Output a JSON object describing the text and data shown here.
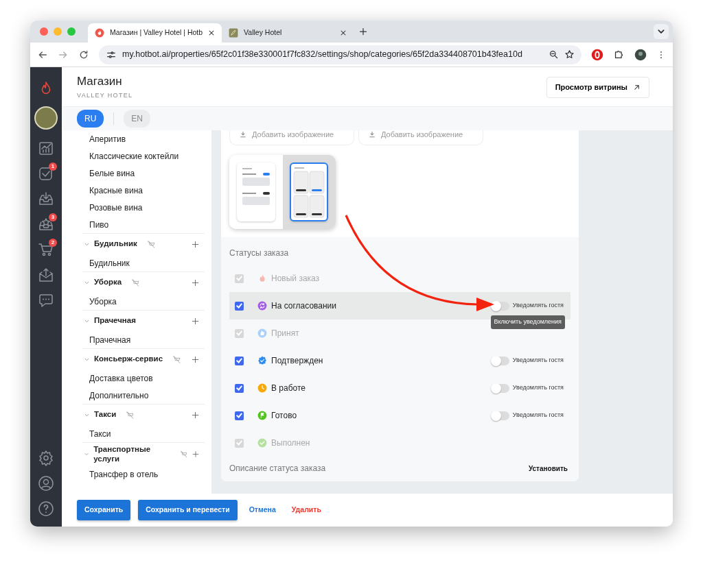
{
  "browser": {
    "tabs": [
      {
        "title": "Магазин | Valley Hotel | Hotb",
        "selected": true
      },
      {
        "title": "Valley Hotel",
        "selected": false
      }
    ],
    "url": "my.hotbot.ai/properties/65f2c01f38e330001f7fc832/settings/shop/categories/65f2da334408701b43fea10d"
  },
  "rail_badges": [
    "1",
    "3",
    "2"
  ],
  "header": {
    "title": "Магазин",
    "subtitle": "VALLEY HOTEL",
    "storefront_button": "Просмотр витрины"
  },
  "languages": [
    {
      "code": "RU",
      "selected": true
    },
    {
      "code": "EN",
      "selected": false
    }
  ],
  "categories": [
    {
      "children": [
        {
          "label": "Аперитив"
        },
        {
          "label": "Классические коктейли"
        },
        {
          "label": "Белые вина"
        },
        {
          "label": "Красные вина"
        },
        {
          "label": "Розовые вина"
        },
        {
          "label": "Пиво"
        }
      ]
    },
    {
      "title": "Будильник",
      "expanded": true,
      "hidden_from_shop": true,
      "children": [
        {
          "label": "Будильник"
        }
      ]
    },
    {
      "title": "Уборка",
      "expanded": true,
      "hidden_from_shop": true,
      "children": [
        {
          "label": "Уборка"
        }
      ]
    },
    {
      "title": "Прачечная",
      "expanded": true,
      "hidden_from_shop": false,
      "children": [
        {
          "label": "Прачечная"
        }
      ]
    },
    {
      "title": "Консьерж-сервис",
      "expanded": true,
      "hidden_from_shop": true,
      "children": [
        {
          "label": "Доставка цветов"
        },
        {
          "label": "Дополнительно"
        }
      ]
    },
    {
      "title": "Такси",
      "expanded": true,
      "hidden_from_shop": true,
      "children": [
        {
          "label": "Такси"
        }
      ]
    },
    {
      "title": "Транспортные услуги",
      "expanded": true,
      "hidden_from_shop": true,
      "children": [
        {
          "label": "Трансфер в отель"
        }
      ]
    }
  ],
  "image_uploads": [
    "Добавить изображение",
    "Добавить изображение"
  ],
  "layouts": [
    {
      "kind": "list",
      "selected": false
    },
    {
      "kind": "grid",
      "selected": true
    }
  ],
  "statuses_title": "Статусы заказа",
  "statuses": [
    {
      "label": "Новый заказ",
      "color": "#f7b6b0",
      "checked": true,
      "disabled": true,
      "highlighted": false
    },
    {
      "label": "На согласовании",
      "color": "#a35ce6",
      "checked": true,
      "disabled": false,
      "highlighted": true,
      "notify": {
        "label": "Уведомлять гостя",
        "on": false
      },
      "tooltip": "Включить уведомления"
    },
    {
      "label": "Принят",
      "color": "#a9d1fb",
      "checked": true,
      "disabled": true,
      "highlighted": false
    },
    {
      "label": "Подтвержден",
      "color": "#2f8cf3",
      "checked": true,
      "disabled": false,
      "highlighted": false,
      "notify": {
        "label": "Уведомлять гостя",
        "on": false
      }
    },
    {
      "label": "В работе",
      "color": "#f7a90a",
      "checked": true,
      "disabled": false,
      "highlighted": false,
      "notify": {
        "label": "Уведомлять гостя",
        "on": false
      }
    },
    {
      "label": "Готово",
      "color": "#52c41a",
      "checked": true,
      "disabled": false,
      "highlighted": false,
      "notify": {
        "label": "Уведомлять гостя",
        "on": false
      }
    },
    {
      "label": "Выполнен",
      "color": "#b4e0a0",
      "checked": true,
      "disabled": true,
      "highlighted": false
    }
  ],
  "description": {
    "label": "Описание статуса заказа",
    "action": "Установить"
  },
  "footer": [
    {
      "label": "Сохранить",
      "kind": "primary"
    },
    {
      "label": "Сохранить и перевести",
      "kind": "primary"
    },
    {
      "label": "Отмена",
      "kind": "link"
    },
    {
      "label": "Удалить",
      "kind": "danger"
    }
  ],
  "annotation": {
    "kind": "arrow"
  }
}
